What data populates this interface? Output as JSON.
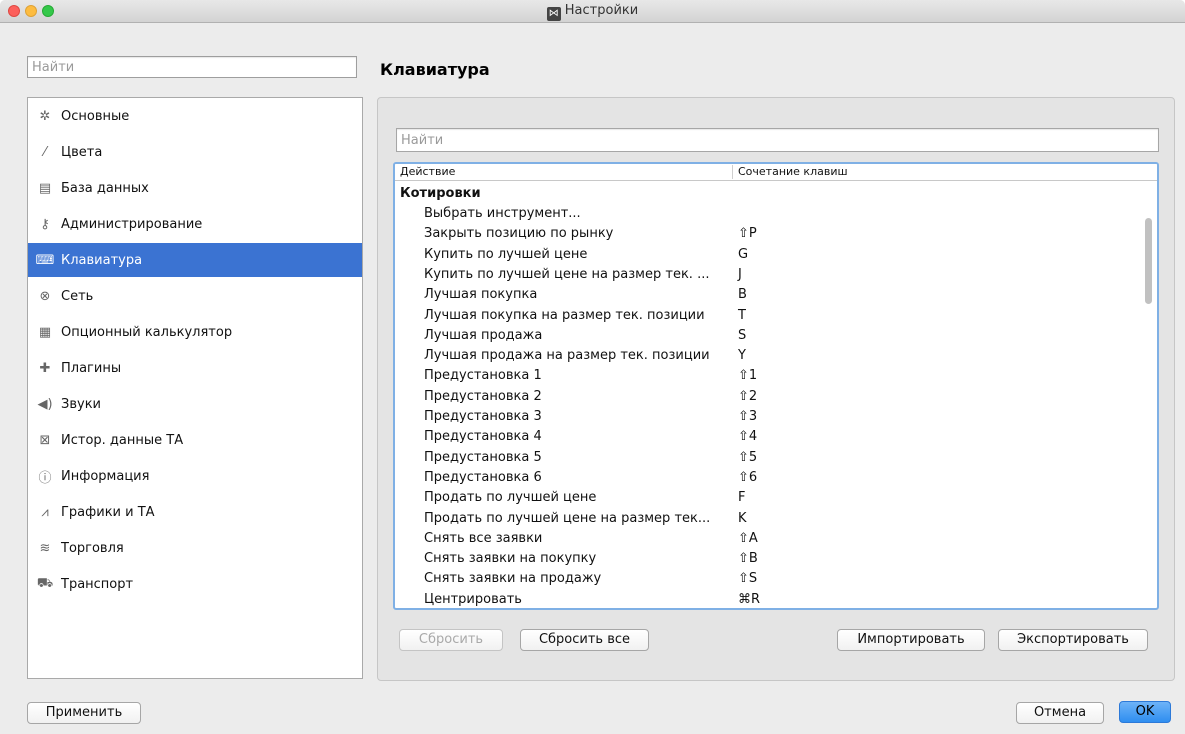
{
  "window": {
    "title": "Настройки",
    "app_icon_glyph": "⋈"
  },
  "left": {
    "search_placeholder": "Найти",
    "items": [
      {
        "label": "Основные",
        "icon": "gear-icon",
        "glyph": "✲"
      },
      {
        "label": "Цвета",
        "icon": "brush-icon",
        "glyph": "⁄"
      },
      {
        "label": "База данных",
        "icon": "database-icon",
        "glyph": "▤"
      },
      {
        "label": "Администрирование",
        "icon": "key-icon",
        "glyph": "⚷"
      },
      {
        "label": "Клавиатура",
        "icon": "keyboard-icon",
        "glyph": "⌨"
      },
      {
        "label": "Сеть",
        "icon": "network-icon",
        "glyph": "⊗"
      },
      {
        "label": "Опционный калькулятор",
        "icon": "calculator-icon",
        "glyph": "▦"
      },
      {
        "label": "Плагины",
        "icon": "puzzle-icon",
        "glyph": "✚"
      },
      {
        "label": "Звуки",
        "icon": "speaker-icon",
        "glyph": "◀)"
      },
      {
        "label": "Истор. данные ТА",
        "icon": "history-chart-icon",
        "glyph": "⊠"
      },
      {
        "label": "Информация",
        "icon": "info-icon",
        "glyph": "ⓘ"
      },
      {
        "label": "Графики и ТА",
        "icon": "chart-icon",
        "glyph": "⩘"
      },
      {
        "label": "Торговля",
        "icon": "coins-icon",
        "glyph": "≋"
      },
      {
        "label": "Транспорт",
        "icon": "transport-icon",
        "glyph": "⛟"
      }
    ],
    "active_index": 4
  },
  "main": {
    "section_title": "Клавиатура",
    "search_placeholder": "Найти",
    "columns": [
      "Действие",
      "Сочетание клавиш"
    ],
    "group": "Котировки",
    "rows": [
      {
        "action": "Выбрать инструмент...",
        "shortcut": ""
      },
      {
        "action": "Закрыть позицию по рынку",
        "shortcut": "⇧P"
      },
      {
        "action": "Купить по лучшей цене",
        "shortcut": "G"
      },
      {
        "action": "Купить по лучшей цене на размер тек. ...",
        "shortcut": "J"
      },
      {
        "action": "Лучшая покупка",
        "shortcut": "B"
      },
      {
        "action": "Лучшая покупка на размер тек. позиции",
        "shortcut": "T"
      },
      {
        "action": "Лучшая продажа",
        "shortcut": "S"
      },
      {
        "action": "Лучшая продажа на размер тек. позиции",
        "shortcut": "Y"
      },
      {
        "action": "Предустановка 1",
        "shortcut": "⇧1"
      },
      {
        "action": "Предустановка 2",
        "shortcut": "⇧2"
      },
      {
        "action": "Предустановка 3",
        "shortcut": "⇧3"
      },
      {
        "action": "Предустановка 4",
        "shortcut": "⇧4"
      },
      {
        "action": "Предустановка 5",
        "shortcut": "⇧5"
      },
      {
        "action": "Предустановка 6",
        "shortcut": "⇧6"
      },
      {
        "action": "Продать по лучшей цене",
        "shortcut": "F"
      },
      {
        "action": "Продать по лучшей цене на размер тек...",
        "shortcut": "K"
      },
      {
        "action": "Снять все заявки",
        "shortcut": "⇧A"
      },
      {
        "action": "Снять заявки на покупку",
        "shortcut": "⇧B"
      },
      {
        "action": "Снять заявки на продажу",
        "shortcut": "⇧S"
      },
      {
        "action": "Центрировать",
        "shortcut": "⌘R"
      }
    ],
    "buttons": {
      "reset": "Сбросить",
      "reset_all": "Сбросить все",
      "import": "Импортировать",
      "export": "Экспортировать"
    }
  },
  "footer": {
    "apply": "Применить",
    "cancel": "Отмена",
    "ok": "OK"
  },
  "colors": {
    "selection": "#3b73d2",
    "focus_ring": "#7fb0e5",
    "ok_button": "#2f8ef0"
  }
}
